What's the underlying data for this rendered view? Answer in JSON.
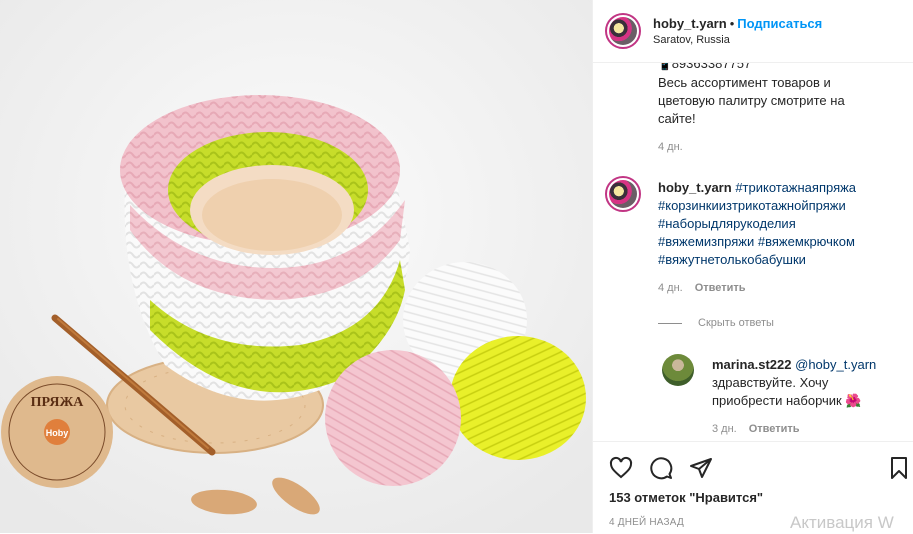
{
  "post": {
    "username": "hoby_t.yarn",
    "dot": "•",
    "follow_label": "Подписаться",
    "location": "Saratov, Russia"
  },
  "caption_tail": {
    "phone_emoji": "📱",
    "phone_partial": "89363387757",
    "lines": [
      "Весь ассортимент товаров и",
      "цветовую палитру смотрите на",
      "сайте!"
    ],
    "time": "4 дн."
  },
  "comment1": {
    "username": "hoby_t.yarn",
    "hashtags": [
      "#трикотажнаяпряжа",
      "#корзинкиизтрикотажнойпряжи",
      "#наборыдлярукоделия",
      "#вяжемизпряжи",
      "#вяжемкрючком",
      "#вяжутнетолькобабушки"
    ],
    "time": "4 дн.",
    "reply_label": "Ответить",
    "hide_replies": "Скрыть ответы"
  },
  "reply1": {
    "username": "marina.st222",
    "mention": "@hoby_t.yarn",
    "text_line1": "здравствуйте. Хочу",
    "text_line2": "приобрести наборчик",
    "emoji": "🌺",
    "time": "3 дн.",
    "reply_label": "Ответить"
  },
  "actions": {
    "likes": "153 отметок \"Нравится\"",
    "date": "4 ДНЕЙ НАЗАД"
  },
  "watermark": "Активация W",
  "photo": {
    "tag_text": "ПРЯЖА",
    "tag_brand": "Hoby"
  }
}
